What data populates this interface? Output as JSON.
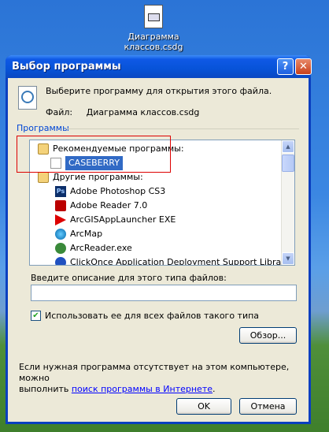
{
  "desktop": {
    "file_label_line1": "Диаграмма",
    "file_label_line2": "классов.csdg"
  },
  "window": {
    "title": "Выбор программы",
    "help_glyph": "?",
    "close_glyph": "✕"
  },
  "prompt": {
    "text": "Выберите программу для открытия этого файла.",
    "file_label": "Файл:",
    "file_name": "Диаграмма классов.csdg"
  },
  "programs": {
    "group_title": "Программы",
    "items": [
      {
        "label": "Рекомендуемые программы:",
        "icon": "folder-icon"
      },
      {
        "label": "CASEBERRY",
        "icon": "document-icon",
        "selected": true
      },
      {
        "label": "Другие программы:",
        "icon": "folder-icon"
      },
      {
        "label": "Adobe Photoshop CS3",
        "icon": "photoshop-icon",
        "icon_text": "Ps"
      },
      {
        "label": "Adobe Reader 7.0",
        "icon": "pdf-icon"
      },
      {
        "label": "ArcGISAppLauncher EXE",
        "icon": "arrow-icon"
      },
      {
        "label": "ArcMap",
        "icon": "globe-icon"
      },
      {
        "label": "ArcReader.exe",
        "icon": "arcreader-icon"
      },
      {
        "label": "ClickOnce Application Deployment Support Library",
        "icon": "clickonce-icon"
      }
    ]
  },
  "description": {
    "label": "Введите описание для этого типа файлов:",
    "value": ""
  },
  "always_use": {
    "label": "Использовать ее для всех файлов такого типа",
    "checked": true,
    "check_glyph": "✔"
  },
  "buttons": {
    "browse": "Обзор...",
    "ok": "OK",
    "cancel": "Отмена"
  },
  "info": {
    "line1": "Если нужная программа отсутствует на этом компьютере, можно",
    "line2_prefix": "выполнить ",
    "link": "поиск программы в Интернете",
    "line2_suffix": "."
  },
  "colors": {
    "title_bar": "#0753d8",
    "selection": "#316ac5",
    "highlight_box": "#dd0000",
    "link": "#0000ff"
  }
}
